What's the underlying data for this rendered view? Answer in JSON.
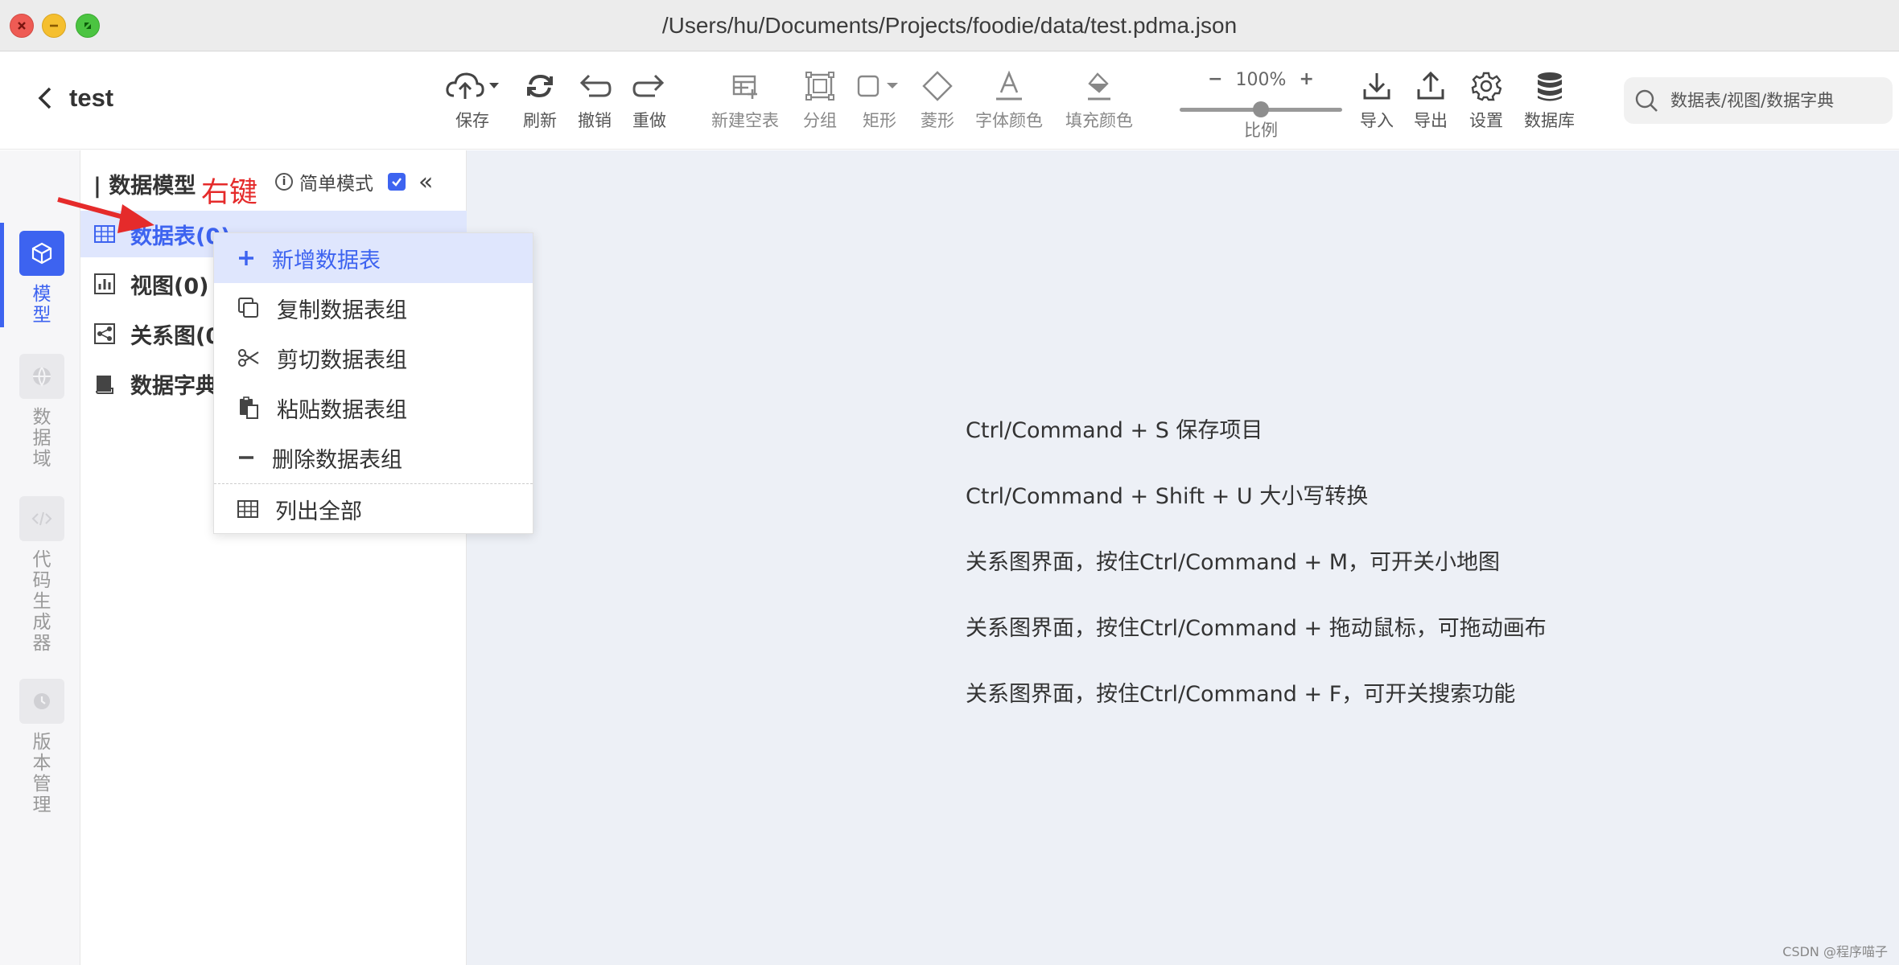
{
  "window": {
    "title": "/Users/hu/Documents/Projects/foodie/data/test.pdma.json"
  },
  "header": {
    "project_name": "test"
  },
  "toolbar": {
    "save": "保存",
    "refresh": "刷新",
    "undo": "撤销",
    "redo": "重做",
    "new_table": "新建空表",
    "group": "分组",
    "rect": "矩形",
    "diamond": "菱形",
    "font_color": "字体颜色",
    "fill_color": "填充颜色",
    "zoom_value": "100%",
    "zoom_label": "比例",
    "zoom_level": 0.5,
    "import": "导入",
    "export": "导出",
    "settings": "设置",
    "database": "数据库"
  },
  "search": {
    "placeholder": "数据表/视图/数据字典"
  },
  "rail": {
    "items": [
      {
        "label": "模型",
        "icon": "cube-icon",
        "active": true
      },
      {
        "label": "数据域",
        "icon": "globe-icon",
        "active": false
      },
      {
        "label": "代码生成器",
        "icon": "code-icon",
        "active": false
      },
      {
        "label": "版本管理",
        "icon": "history-icon",
        "active": false
      }
    ]
  },
  "panel": {
    "title": "数据模型",
    "annotation": "右键",
    "simple_mode": "简单模式",
    "simple_mode_checked": true,
    "tree": [
      {
        "label": "数据表(0)",
        "icon": "table-icon"
      },
      {
        "label": "视图(0)",
        "icon": "chart-icon"
      },
      {
        "label": "关系图(0)",
        "icon": "relation-icon"
      },
      {
        "label": "数据字典",
        "icon": "book-icon"
      }
    ]
  },
  "context_menu": {
    "items": [
      {
        "label": "新增数据表",
        "icon": "plus-icon"
      },
      {
        "label": "复制数据表组",
        "icon": "copy-icon"
      },
      {
        "label": "剪切数据表组",
        "icon": "scissors-icon"
      },
      {
        "label": "粘贴数据表组",
        "icon": "paste-icon"
      },
      {
        "label": "删除数据表组",
        "icon": "minus-icon"
      },
      {
        "label": "列出全部",
        "icon": "table-icon"
      }
    ]
  },
  "hints": [
    "Ctrl/Command + S 保存项目",
    "Ctrl/Command + Shift + U 大小写转换",
    "关系图界面，按住Ctrl/Command + M，可开关小地图",
    "关系图界面，按住Ctrl/Command + 拖动鼠标，可拖动画布",
    "关系图界面，按住Ctrl/Command + F，可开关搜索功能"
  ],
  "watermark": "CSDN @程序喵子",
  "colors": {
    "accent": "#3d63f0",
    "annotation": "#e52b2b",
    "canvas": "#edf0f6"
  }
}
